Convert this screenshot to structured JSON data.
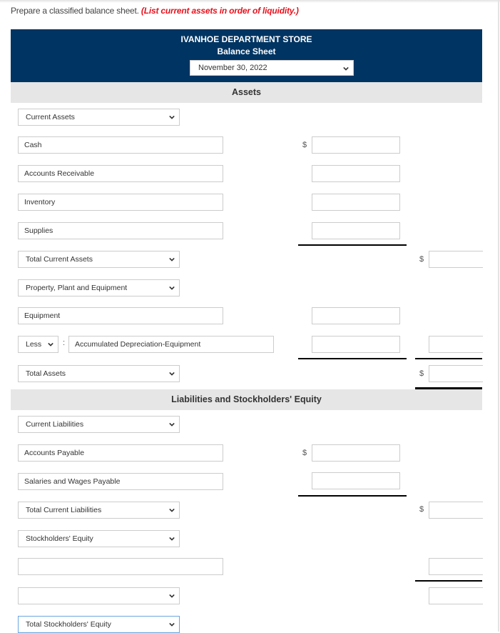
{
  "instructions": {
    "text": "Prepare a classified balance sheet.",
    "emphasis": "(List current assets in order of liquidity.)",
    "emphasis_color": "#e8111c"
  },
  "header": {
    "company": "IVANHOE DEPARTMENT STORE",
    "statement": "Balance Sheet",
    "date_selected": "November 30, 2022",
    "bg_color": "#003462"
  },
  "sections": {
    "assets": "Assets",
    "liabilities_equity": "Liabilities and Stockholders' Equity"
  },
  "rows": {
    "current_assets_heading": "Current Assets",
    "cash": "Cash",
    "accounts_receivable": "Accounts Receivable",
    "inventory": "Inventory",
    "supplies": "Supplies",
    "total_current_assets": "Total Current Assets",
    "ppe_heading": "Property, Plant and Equipment",
    "equipment": "Equipment",
    "less_select": "Less",
    "accum_dep": "Accumulated Depreciation-Equipment",
    "total_assets": "Total Assets",
    "current_liabilities_heading": "Current Liabilities",
    "accounts_payable": "Accounts Payable",
    "salaries_wages_payable": "Salaries and Wages Payable",
    "total_current_liabilities": "Total Current Liabilities",
    "stockholders_equity_heading": "Stockholders' Equity",
    "equity_item_1": "",
    "equity_item_2_select": "",
    "total_stockholders_equity": "Total Stockholders' Equity"
  },
  "currency_symbol": "$",
  "amounts": {
    "cash": "",
    "accounts_receivable": "",
    "inventory": "",
    "supplies": "",
    "total_current_assets": "",
    "equipment": "",
    "accum_dep": "",
    "net_ppe": "",
    "total_assets": "",
    "accounts_payable": "",
    "salaries_wages_payable": "",
    "total_current_liabilities": "",
    "equity_item_1": "",
    "equity_item_2": ""
  }
}
